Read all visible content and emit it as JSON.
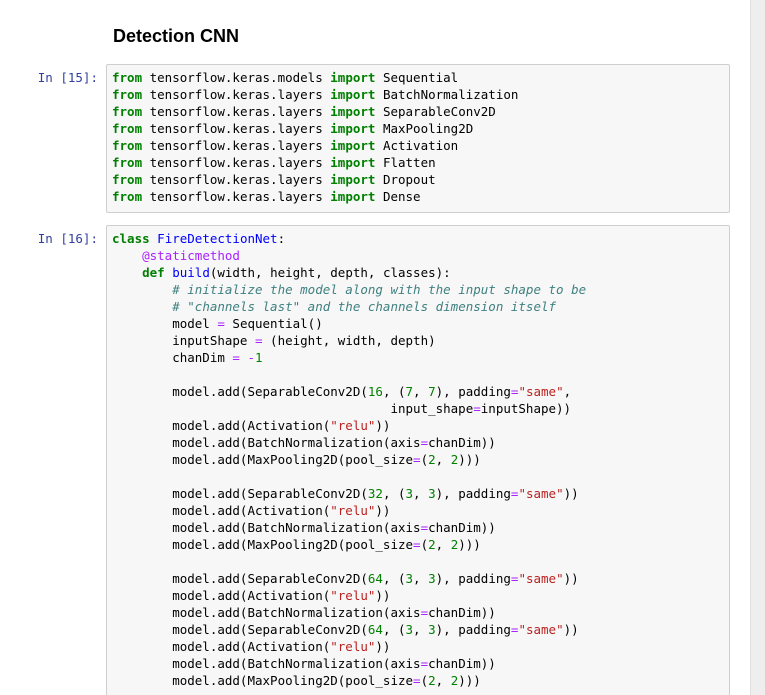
{
  "markdown": {
    "title": "Detection CNN"
  },
  "cells": [
    {
      "prompt": "In [15]:",
      "lines": [
        [
          {
            "t": "from",
            "c": "kw"
          },
          {
            "t": " tensorflow.keras.models "
          },
          {
            "t": "import",
            "c": "kw"
          },
          {
            "t": " Sequential"
          }
        ],
        [
          {
            "t": "from",
            "c": "kw"
          },
          {
            "t": " tensorflow.keras.layers "
          },
          {
            "t": "import",
            "c": "kw"
          },
          {
            "t": " BatchNormalization"
          }
        ],
        [
          {
            "t": "from",
            "c": "kw"
          },
          {
            "t": " tensorflow.keras.layers "
          },
          {
            "t": "import",
            "c": "kw"
          },
          {
            "t": " SeparableConv2D"
          }
        ],
        [
          {
            "t": "from",
            "c": "kw"
          },
          {
            "t": " tensorflow.keras.layers "
          },
          {
            "t": "import",
            "c": "kw"
          },
          {
            "t": " MaxPooling2D"
          }
        ],
        [
          {
            "t": "from",
            "c": "kw"
          },
          {
            "t": " tensorflow.keras.layers "
          },
          {
            "t": "import",
            "c": "kw"
          },
          {
            "t": " Activation"
          }
        ],
        [
          {
            "t": "from",
            "c": "kw"
          },
          {
            "t": " tensorflow.keras.layers "
          },
          {
            "t": "import",
            "c": "kw"
          },
          {
            "t": " Flatten"
          }
        ],
        [
          {
            "t": "from",
            "c": "kw"
          },
          {
            "t": " tensorflow.keras.layers "
          },
          {
            "t": "import",
            "c": "kw"
          },
          {
            "t": " Dropout"
          }
        ],
        [
          {
            "t": "from",
            "c": "kw"
          },
          {
            "t": " tensorflow.keras.layers "
          },
          {
            "t": "import",
            "c": "kw"
          },
          {
            "t": " Dense"
          }
        ]
      ]
    },
    {
      "prompt": "In [16]:",
      "lines": [
        [
          {
            "t": "class",
            "c": "kw"
          },
          {
            "t": " "
          },
          {
            "t": "FireDetectionNet",
            "c": "nm"
          },
          {
            "t": ":"
          }
        ],
        [
          {
            "t": "    "
          },
          {
            "t": "@staticmethod",
            "c": "dec"
          }
        ],
        [
          {
            "t": "    "
          },
          {
            "t": "def",
            "c": "kw"
          },
          {
            "t": " "
          },
          {
            "t": "build",
            "c": "nm"
          },
          {
            "t": "(width, height, depth, classes):"
          }
        ],
        [
          {
            "t": "        "
          },
          {
            "t": "# initialize the model along with the input shape to be",
            "c": "cm"
          }
        ],
        [
          {
            "t": "        "
          },
          {
            "t": "# \"channels last\" and the channels dimension itself",
            "c": "cm"
          }
        ],
        [
          {
            "t": "        model "
          },
          {
            "t": "=",
            "c": "op"
          },
          {
            "t": " Sequential()"
          }
        ],
        [
          {
            "t": "        inputShape "
          },
          {
            "t": "=",
            "c": "op"
          },
          {
            "t": " (height, width, depth)"
          }
        ],
        [
          {
            "t": "        chanDim "
          },
          {
            "t": "=",
            "c": "op"
          },
          {
            "t": " "
          },
          {
            "t": "-",
            "c": "op"
          },
          {
            "t": "1",
            "c": "num"
          }
        ],
        [
          {
            "t": ""
          }
        ],
        [
          {
            "t": "        model.add(SeparableConv2D("
          },
          {
            "t": "16",
            "c": "num"
          },
          {
            "t": ", ("
          },
          {
            "t": "7",
            "c": "num"
          },
          {
            "t": ", "
          },
          {
            "t": "7",
            "c": "num"
          },
          {
            "t": "), padding"
          },
          {
            "t": "=",
            "c": "op"
          },
          {
            "t": "\"same\"",
            "c": "str"
          },
          {
            "t": ","
          }
        ],
        [
          {
            "t": "                                     input_shape"
          },
          {
            "t": "=",
            "c": "op"
          },
          {
            "t": "inputShape))"
          }
        ],
        [
          {
            "t": "        model.add(Activation("
          },
          {
            "t": "\"relu\"",
            "c": "str"
          },
          {
            "t": "))"
          }
        ],
        [
          {
            "t": "        model.add(BatchNormalization(axis"
          },
          {
            "t": "=",
            "c": "op"
          },
          {
            "t": "chanDim))"
          }
        ],
        [
          {
            "t": "        model.add(MaxPooling2D(pool_size"
          },
          {
            "t": "=",
            "c": "op"
          },
          {
            "t": "("
          },
          {
            "t": "2",
            "c": "num"
          },
          {
            "t": ", "
          },
          {
            "t": "2",
            "c": "num"
          },
          {
            "t": ")))"
          }
        ],
        [
          {
            "t": ""
          }
        ],
        [
          {
            "t": "        model.add(SeparableConv2D("
          },
          {
            "t": "32",
            "c": "num"
          },
          {
            "t": ", ("
          },
          {
            "t": "3",
            "c": "num"
          },
          {
            "t": ", "
          },
          {
            "t": "3",
            "c": "num"
          },
          {
            "t": "), padding"
          },
          {
            "t": "=",
            "c": "op"
          },
          {
            "t": "\"same\"",
            "c": "str"
          },
          {
            "t": "))"
          }
        ],
        [
          {
            "t": "        model.add(Activation("
          },
          {
            "t": "\"relu\"",
            "c": "str"
          },
          {
            "t": "))"
          }
        ],
        [
          {
            "t": "        model.add(BatchNormalization(axis"
          },
          {
            "t": "=",
            "c": "op"
          },
          {
            "t": "chanDim))"
          }
        ],
        [
          {
            "t": "        model.add(MaxPooling2D(pool_size"
          },
          {
            "t": "=",
            "c": "op"
          },
          {
            "t": "("
          },
          {
            "t": "2",
            "c": "num"
          },
          {
            "t": ", "
          },
          {
            "t": "2",
            "c": "num"
          },
          {
            "t": ")))"
          }
        ],
        [
          {
            "t": ""
          }
        ],
        [
          {
            "t": "        model.add(SeparableConv2D("
          },
          {
            "t": "64",
            "c": "num"
          },
          {
            "t": ", ("
          },
          {
            "t": "3",
            "c": "num"
          },
          {
            "t": ", "
          },
          {
            "t": "3",
            "c": "num"
          },
          {
            "t": "), padding"
          },
          {
            "t": "=",
            "c": "op"
          },
          {
            "t": "\"same\"",
            "c": "str"
          },
          {
            "t": "))"
          }
        ],
        [
          {
            "t": "        model.add(Activation("
          },
          {
            "t": "\"relu\"",
            "c": "str"
          },
          {
            "t": "))"
          }
        ],
        [
          {
            "t": "        model.add(BatchNormalization(axis"
          },
          {
            "t": "=",
            "c": "op"
          },
          {
            "t": "chanDim))"
          }
        ],
        [
          {
            "t": "        model.add(SeparableConv2D("
          },
          {
            "t": "64",
            "c": "num"
          },
          {
            "t": ", ("
          },
          {
            "t": "3",
            "c": "num"
          },
          {
            "t": ", "
          },
          {
            "t": "3",
            "c": "num"
          },
          {
            "t": "), padding"
          },
          {
            "t": "=",
            "c": "op"
          },
          {
            "t": "\"same\"",
            "c": "str"
          },
          {
            "t": "))"
          }
        ],
        [
          {
            "t": "        model.add(Activation("
          },
          {
            "t": "\"relu\"",
            "c": "str"
          },
          {
            "t": "))"
          }
        ],
        [
          {
            "t": "        model.add(BatchNormalization(axis"
          },
          {
            "t": "=",
            "c": "op"
          },
          {
            "t": "chanDim))"
          }
        ],
        [
          {
            "t": "        model.add(MaxPooling2D(pool_size"
          },
          {
            "t": "=",
            "c": "op"
          },
          {
            "t": "("
          },
          {
            "t": "2",
            "c": "num"
          },
          {
            "t": ", "
          },
          {
            "t": "2",
            "c": "num"
          },
          {
            "t": ")))"
          }
        ]
      ]
    }
  ],
  "colors": {
    "keyword": "#008000",
    "name": "#0000ff",
    "decorator": "#aa22ff",
    "comment": "#408080",
    "string": "#ba2121",
    "prompt": "#303f9f",
    "cell_background": "#f7f7f7",
    "cell_border": "#cfcfcf"
  }
}
